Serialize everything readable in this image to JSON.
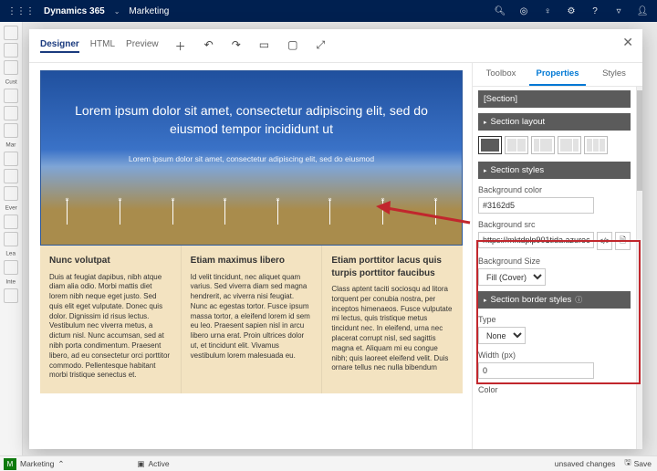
{
  "app": {
    "name": "Dynamics 365",
    "area": "Marketing"
  },
  "topIcons": [
    "search",
    "record",
    "bulb",
    "gear",
    "help",
    "filter",
    "user"
  ],
  "designer": {
    "tabs": [
      "Designer",
      "HTML",
      "Preview"
    ],
    "activeTab": "Designer",
    "sectionLabel": "Section"
  },
  "hero": {
    "headline": "Lorem ipsum dolor sit amet, consectetur adipiscing elit, sed do eiusmod tempor incididunt ut",
    "sub": "Lorem ipsum dolor sit amet, consectetur adipiscing elit, sed do eiusmod"
  },
  "cols": [
    {
      "h": "Nunc volutpat",
      "p": "Duis at feugiat dapibus, nibh atque diam alia odio. Morbi mattis diet lorem nibh neque eget justo. Sed quis elit eget vulputate. Donec quis dolor. Dignissim id risus lectus. Vestibulum nec viverra metus, a dictum nisl. Nunc accumsan, sed at nibh porta condimentum. Praesent libero, ad eu consectetur orci porttitor commodo. Pellentesque habitant morbi tristique senectus et."
    },
    {
      "h": "Etiam maximus libero",
      "p": "Id velit tincidunt, nec aliquet quam varius. Sed viverra diam sed magna hendrerit, ac viverra nisi feugiat. Nunc ac egestas tortor. Fusce ipsum massa tortor, a eleifend lorem id sem eu leo. Praesent sapien nisl in arcu libero urna erat. Proin ultrices dolor ut, et tincidunt elit. Vivamus vestibulum lorem malesuada eu."
    },
    {
      "h": "Etiam porttitor lacus quis turpis porttitor faucibus",
      "p": "Class aptent taciti sociosqu ad litora torquent per conubia nostra, per inceptos himenaeos. Fusce vulputate mi lectus, quis tristique metus tincidunt nec. In eleifend, urna nec placerat corrupt nisl, sed sagittis magna et. Aliquam mi eu congue nibh; quis laoreet eleifend velit. Duis ornare tellus nec nulla bibendum"
    }
  ],
  "panel": {
    "tabs": [
      "Toolbox",
      "Properties",
      "Styles"
    ],
    "activeTab": "Properties",
    "breadcrumb": "[Section]",
    "groups": {
      "layout": "Section layout",
      "styles": "Section styles",
      "border": "Section border styles"
    },
    "fields": {
      "bgColorLabel": "Background color",
      "bgColor": "#3162d5",
      "bgSrcLabel": "Background src",
      "bgSrc": "https://mktdplp901tida.azureedge.net/c",
      "bgSizeLabel": "Background Size",
      "bgSize": "Fill (Cover)",
      "typeLabel": "Type",
      "type": "None",
      "widthLabel": "Width (px)",
      "width": "0",
      "colorLabel": "Color"
    }
  },
  "leftNav": [
    "Cust",
    "Mar",
    "Ever",
    "Lea",
    "Inte"
  ],
  "footer": {
    "badge": "M",
    "area": "Marketing",
    "status": "Active",
    "msg": "unsaved changes",
    "save": "Save"
  }
}
